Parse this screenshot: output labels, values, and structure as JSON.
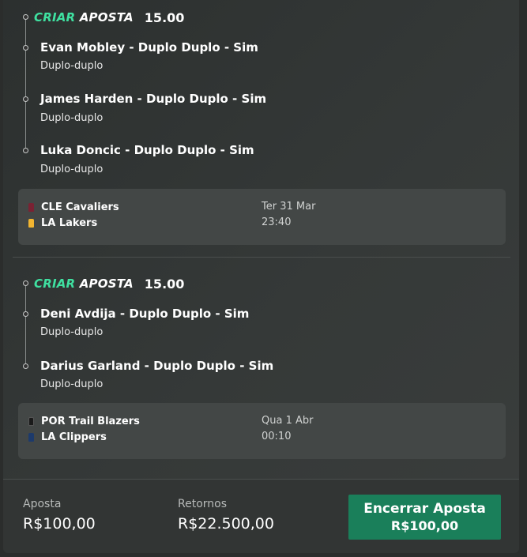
{
  "bets": [
    {
      "brand_part1": "CRIAR",
      "brand_part2": "APOSTA",
      "odds": "15.00",
      "selections": [
        {
          "title": "Evan Mobley - Duplo Duplo - Sim",
          "market": "Duplo-duplo"
        },
        {
          "title": "James Harden - Duplo Duplo - Sim",
          "market": "Duplo-duplo"
        },
        {
          "title": "Luka Doncic - Duplo Duplo - Sim",
          "market": "Duplo-duplo"
        }
      ],
      "match": {
        "home": "CLE Cavaliers",
        "away": "LA Lakers",
        "date": "Ter 31 Mar",
        "time": "23:40",
        "home_color": "#7a2233",
        "away_color": "#f2b531"
      }
    },
    {
      "brand_part1": "CRIAR",
      "brand_part2": "APOSTA",
      "odds": "15.00",
      "selections": [
        {
          "title": "Deni Avdija - Duplo Duplo - Sim",
          "market": "Duplo-duplo"
        },
        {
          "title": "Darius Garland - Duplo Duplo - Sim",
          "market": "Duplo-duplo"
        }
      ],
      "match": {
        "home": "POR Trail Blazers",
        "away": "LA Clippers",
        "date": "Qua 1 Abr",
        "time": "00:10",
        "home_color": "#1a1a1a",
        "away_color": "#1d3a6b"
      }
    }
  ],
  "footer": {
    "stake_label": "Aposta",
    "stake_value": "R$100,00",
    "returns_label": "Retornos",
    "returns_value": "R$22.500,00",
    "cashout_label": "Encerrar Aposta",
    "cashout_value": "R$100,00"
  },
  "colors": {
    "brand_accent": "#3fe0a0",
    "cashout_bg": "#1a7f5a"
  }
}
